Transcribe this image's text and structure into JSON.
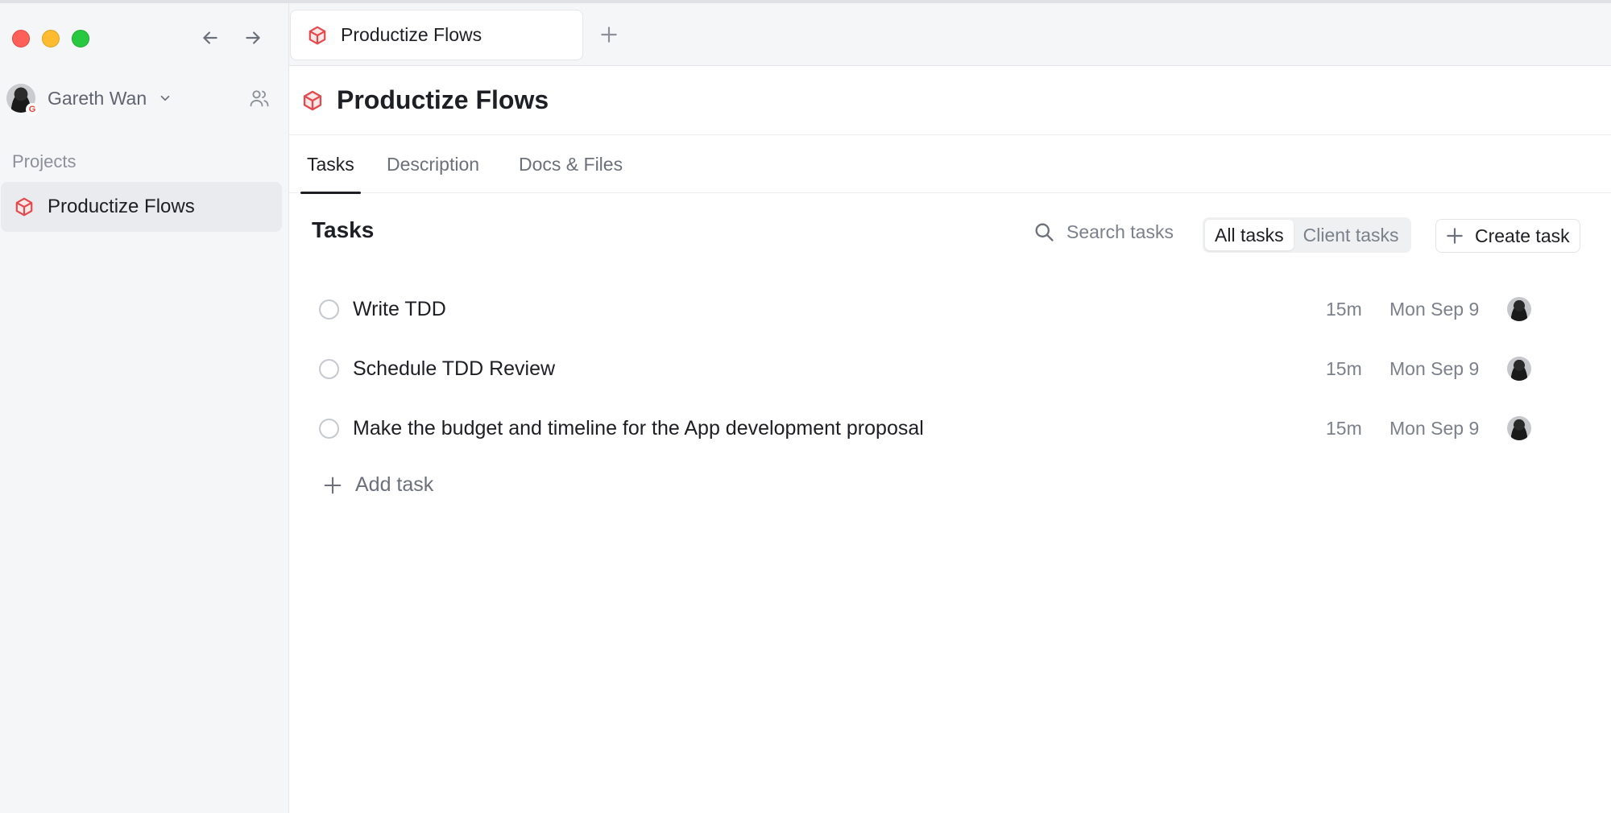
{
  "user": {
    "name": "Gareth Wan",
    "badge": "G"
  },
  "sidebar": {
    "section_label": "Projects",
    "projects": [
      {
        "label": "Productize Flows",
        "icon": "cube-icon",
        "color": "#e5484d"
      }
    ]
  },
  "window_tab": {
    "label": "Productize Flows"
  },
  "page": {
    "title": "Productize Flows"
  },
  "subtabs": [
    {
      "label": "Tasks"
    },
    {
      "label": "Description"
    },
    {
      "label": "Docs & Files"
    }
  ],
  "tasks_panel": {
    "heading": "Tasks",
    "search_placeholder": "Search tasks",
    "filters": [
      {
        "label": "All tasks",
        "active": true
      },
      {
        "label": "Client tasks",
        "active": false
      }
    ],
    "create_label": "Create task",
    "add_label": "Add task"
  },
  "tasks": [
    {
      "title": "Write TDD",
      "duration": "15m",
      "date": "Mon Sep 9"
    },
    {
      "title": "Schedule TDD Review",
      "duration": "15m",
      "date": "Mon Sep 9"
    },
    {
      "title": "Make the budget and timeline for the App development proposal",
      "duration": "15m",
      "date": "Mon Sep 9"
    }
  ],
  "colors": {
    "accent": "#e5484d",
    "text": "#1d1f24",
    "muted": "#7b808b"
  }
}
